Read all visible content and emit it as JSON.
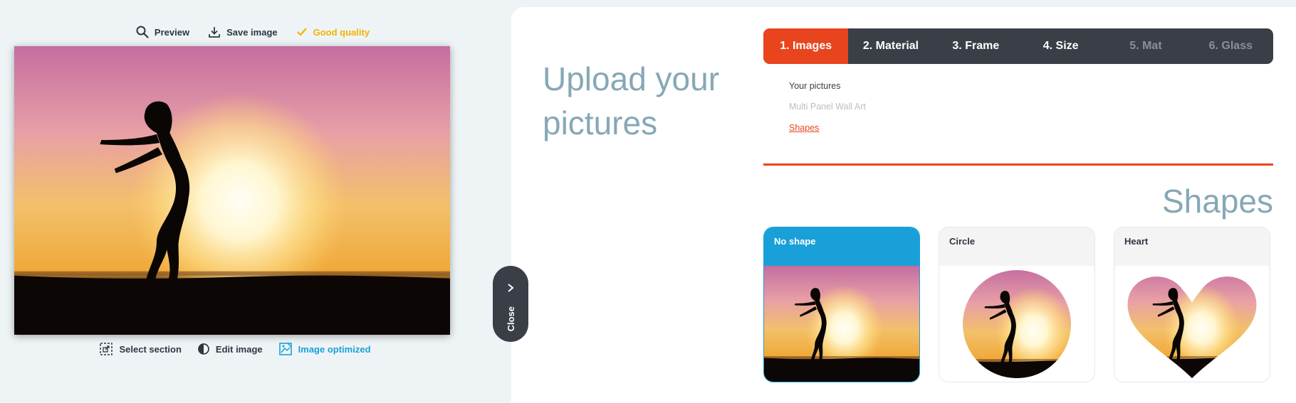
{
  "toolbar": {
    "preview": "Preview",
    "save_image": "Save image",
    "quality": "Good quality"
  },
  "bottom_toolbar": {
    "select_section": "Select section",
    "edit_image": "Edit image",
    "image_optimized": "Image optimized"
  },
  "close_label": "Close",
  "page_title": "Upload your pictures",
  "steps": [
    {
      "label": "1. Images",
      "state": "active"
    },
    {
      "label": "2. Material",
      "state": "enabled"
    },
    {
      "label": "3. Frame",
      "state": "enabled"
    },
    {
      "label": "4. Size",
      "state": "enabled"
    },
    {
      "label": "5. Mat",
      "state": "disabled"
    },
    {
      "label": "6. Glass",
      "state": "disabled"
    }
  ],
  "subnav": {
    "your_pictures": "Your pictures",
    "multi_panel": "Multi Panel Wall Art",
    "shapes": "Shapes"
  },
  "section_heading": "Shapes",
  "shapes": [
    {
      "label": "No shape",
      "selected": true
    },
    {
      "label": "Circle",
      "selected": false
    },
    {
      "label": "Heart",
      "selected": false
    }
  ],
  "colors": {
    "accent": "#e8451e",
    "selected": "#1aa0d8",
    "quality": "#f0b400",
    "dark": "#3a3f47",
    "heading": "#86a8b6"
  },
  "icons": {
    "preview": "magnifier-icon",
    "save": "download-icon",
    "quality": "checkmark-icon",
    "select_section": "crop-icon",
    "edit": "contrast-icon",
    "optimized": "image-enhance-icon",
    "close": "chevron-right-icon"
  }
}
